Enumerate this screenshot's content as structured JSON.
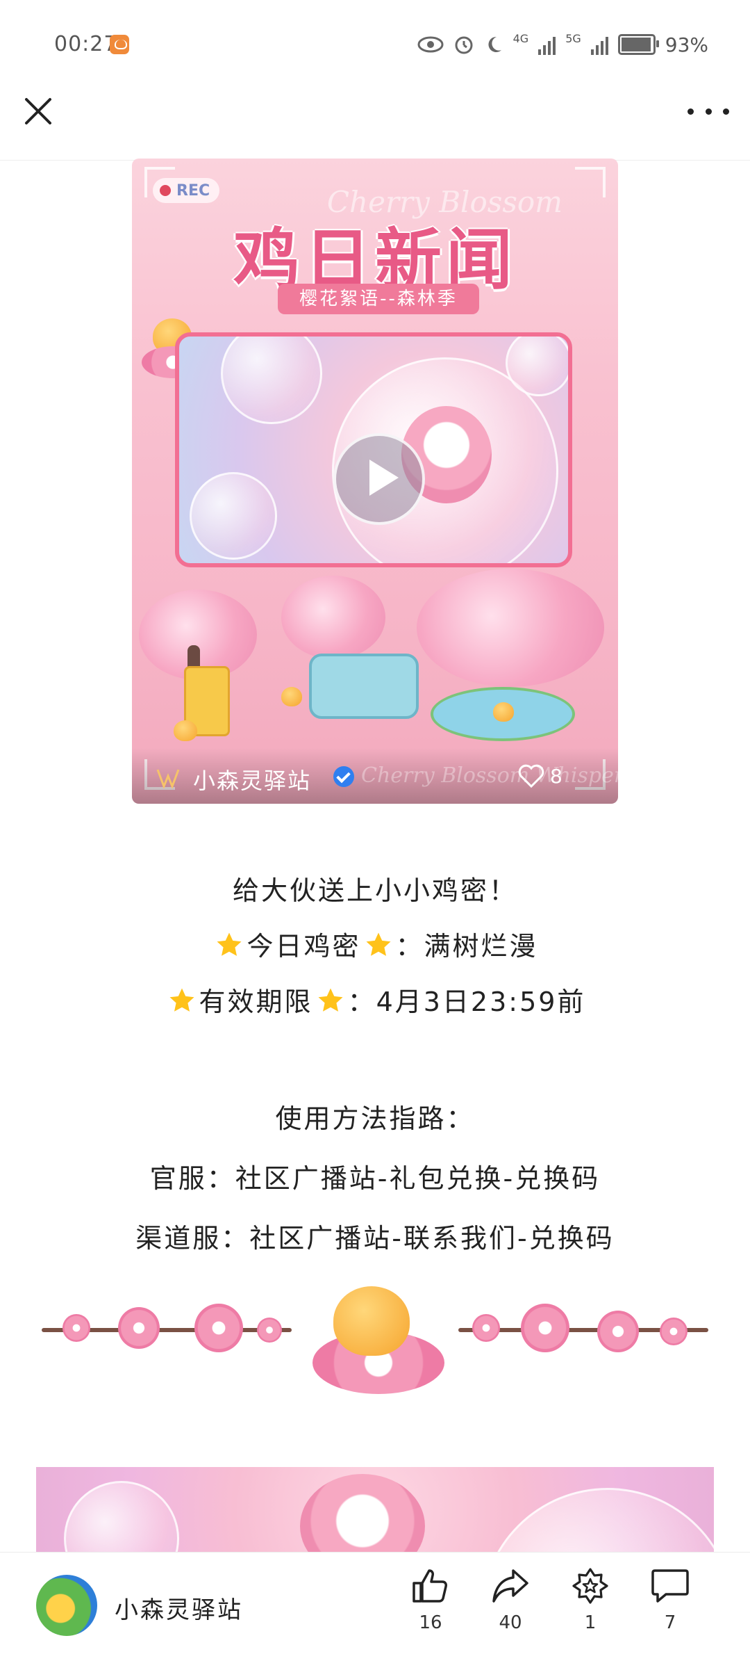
{
  "status_bar": {
    "time": "00:27",
    "network_1": "4G",
    "network_2": "5G",
    "battery": "93%"
  },
  "video_card": {
    "rec_label": "REC",
    "headline": "鸡日新闻",
    "script_text": "Cherry Blossom",
    "subtitle": "樱花絮语--森林季",
    "account_name": "小森灵驿站",
    "likes": "8",
    "footer_script": "Cherry Blossom Whispers"
  },
  "post": {
    "line1": "给大伙送上小小鸡密！",
    "line2_label": "今日鸡密",
    "line2_value": "：满树烂漫",
    "line3_label": "有效期限",
    "line3_value": "：4月3日23:59前",
    "usage_title": "使用方法指路：",
    "usage_official": "官服：社区广播站-礼包兑换-兑换码",
    "usage_channel": "渠道服：社区广播站-联系我们-兑换码"
  },
  "bottom_bar": {
    "author": "小森灵驿站",
    "like_count": "16",
    "share_count": "40",
    "collect_count": "1",
    "comment_count": "7"
  },
  "colors": {
    "brand_pink": "#e85a86",
    "verified_blue": "#2f7ff0"
  }
}
